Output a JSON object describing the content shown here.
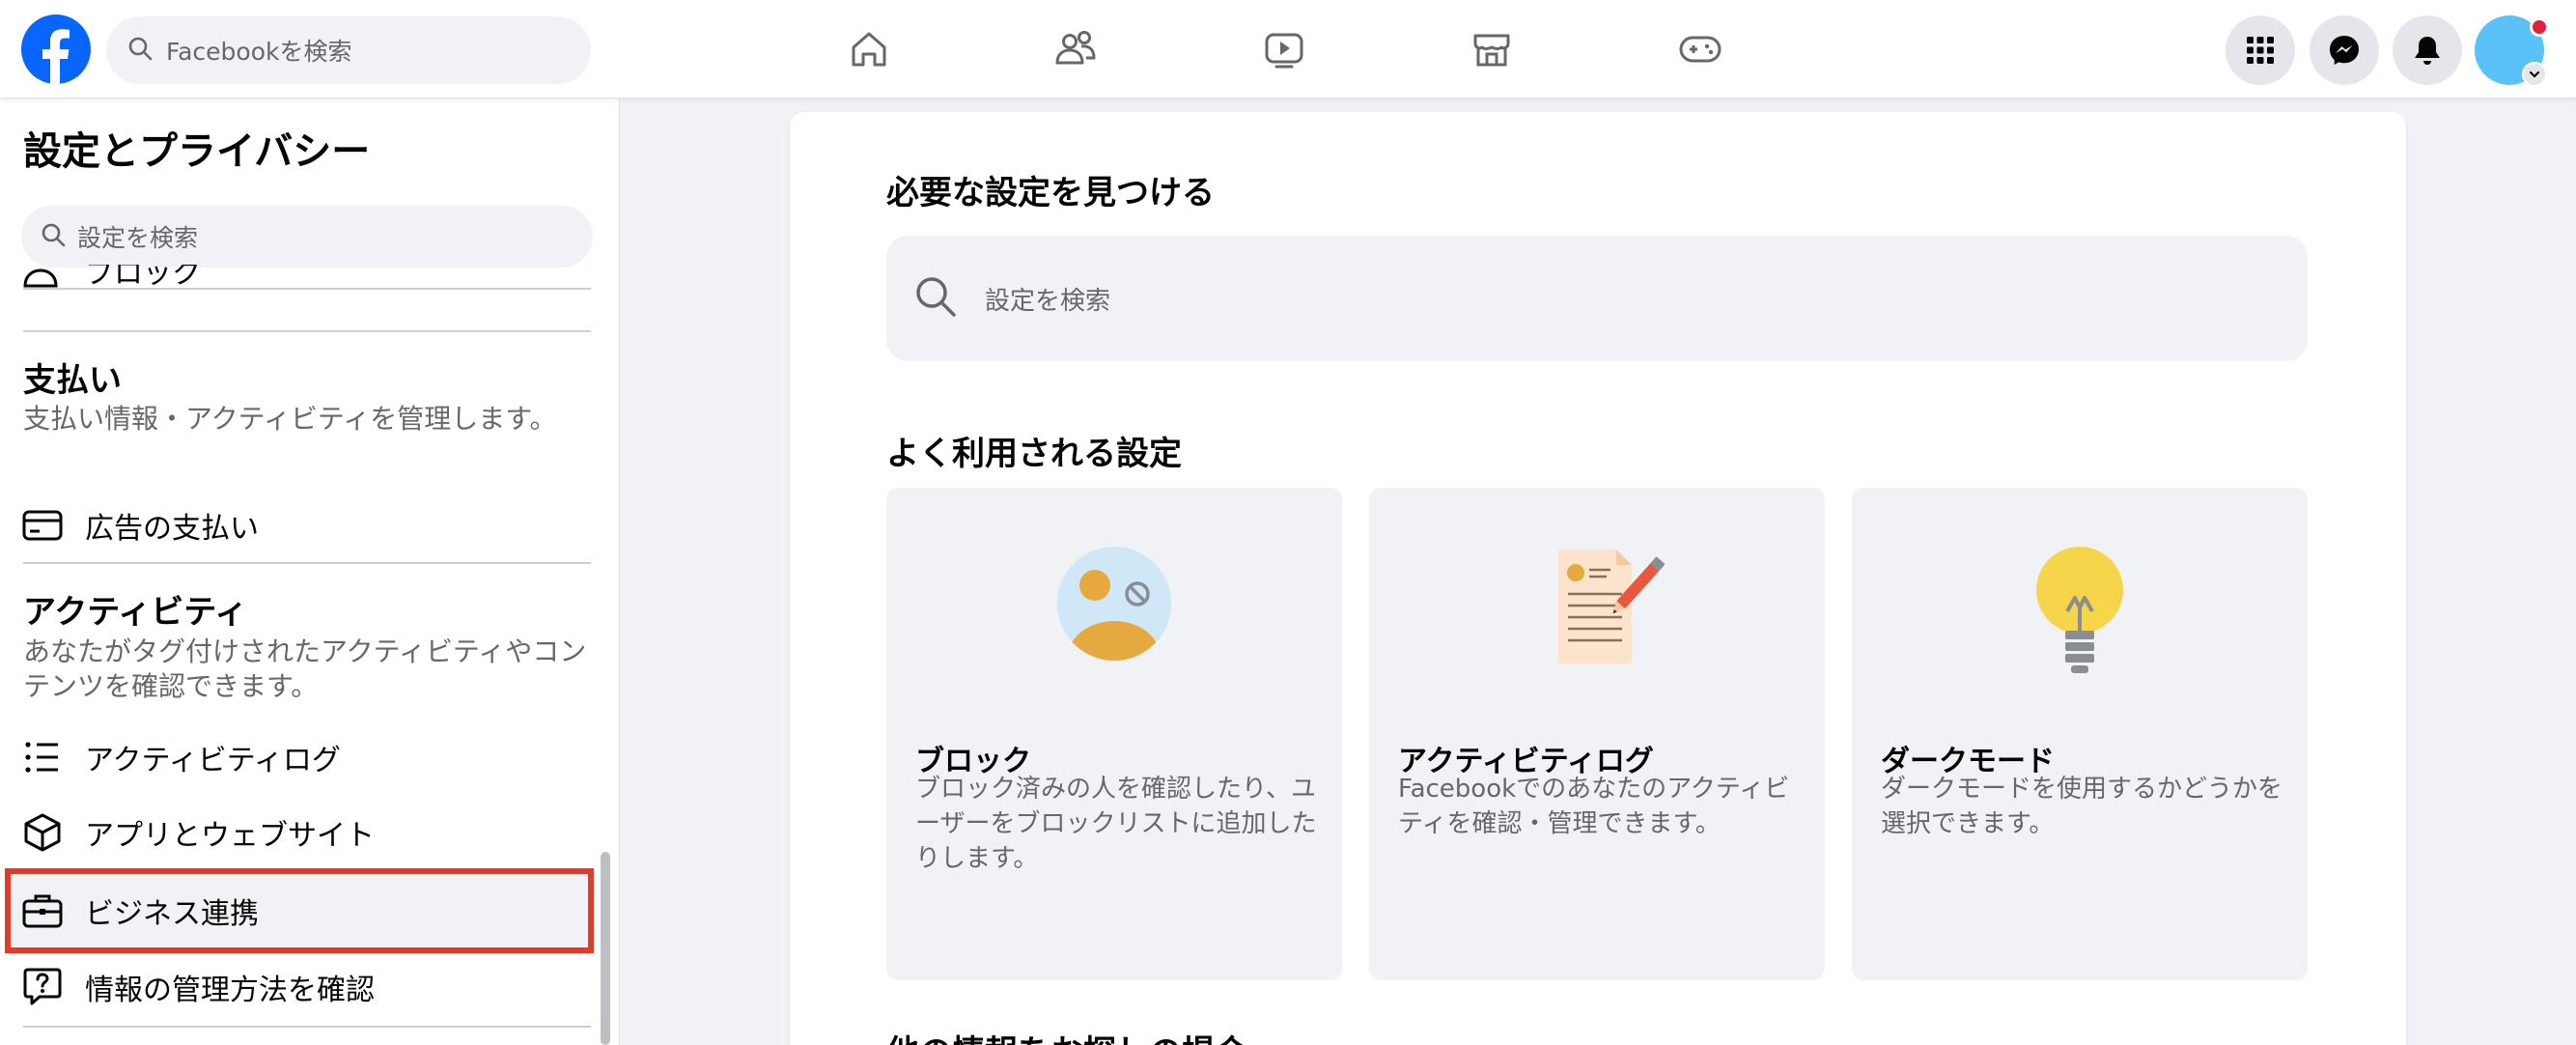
{
  "topbar": {
    "search_placeholder": "Facebookを検索",
    "nav_icons": [
      "home-icon",
      "friends-icon",
      "video-icon",
      "marketplace-icon",
      "gaming-icon"
    ],
    "right_icons": [
      "menu-grid-icon",
      "messenger-icon",
      "bell-icon"
    ],
    "notification_color": "#e41e3f",
    "brand_color": "#0866ff"
  },
  "sidebar": {
    "title": "設定とプライバシー",
    "search_placeholder": "設定を検索",
    "cut_item_label": "ブロック",
    "payments": {
      "title": "支払い",
      "description": "支払い情報・アクティビティを管理します。",
      "items": [
        {
          "label": "広告の支払い",
          "icon": "credit-card-icon"
        }
      ]
    },
    "activity": {
      "title": "アクティビティ",
      "description": "あなたがタグ付けされたアクティビティやコンテンツを確認できます。",
      "items": [
        {
          "label": "アクティビティログ",
          "icon": "list-icon"
        },
        {
          "label": "アプリとウェブサイト",
          "icon": "cube-icon"
        },
        {
          "label": "ビジネス連携",
          "icon": "briefcase-icon",
          "highlighted": true
        },
        {
          "label": "情報の管理方法を確認",
          "icon": "question-bubble-icon"
        }
      ]
    },
    "highlight_color": "#e53a29"
  },
  "main": {
    "find_heading": "必要な設定を見つける",
    "search_placeholder": "設定を検索",
    "popular_heading": "よく利用される設定",
    "tiles": [
      {
        "title": "ブロック",
        "description": "ブロック済みの人を確認したり、ユーザーをブロックリストに追加したりします。",
        "icon": "block-person-illustration"
      },
      {
        "title": "アクティビティログ",
        "description": "Facebookでのあなたのアクティビティを確認・管理できます。",
        "icon": "document-pen-illustration"
      },
      {
        "title": "ダークモード",
        "description": "ダークモードを使用するかどうかを選択できます。",
        "icon": "lightbulb-illustration"
      }
    ],
    "bottom_heading": "他の情報をお探しの場合"
  }
}
